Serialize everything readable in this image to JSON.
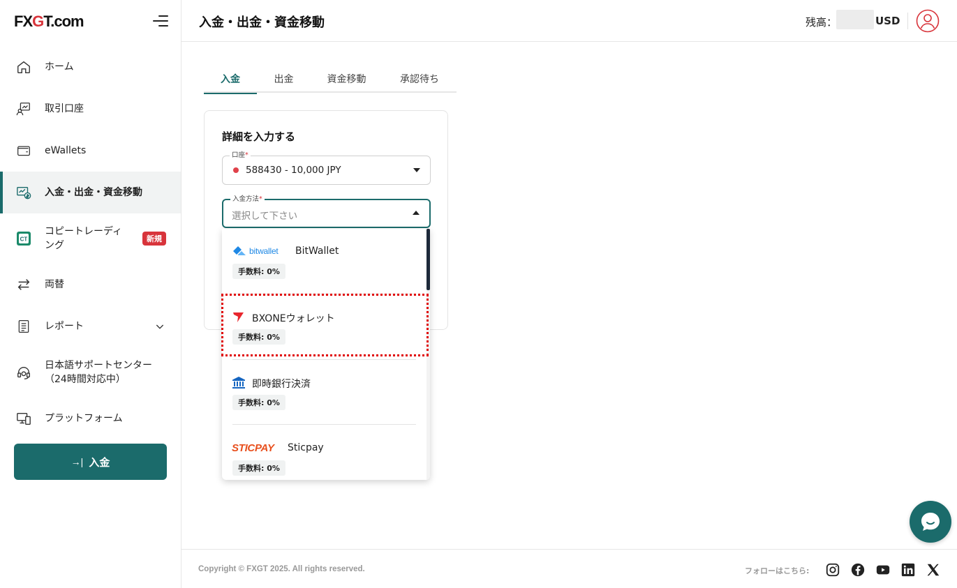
{
  "brand": {
    "logo_prefix": "FX",
    "logo_accent": "G",
    "logo_suffix": "T.com"
  },
  "sidebar": {
    "items": [
      {
        "label": "ホーム",
        "icon": "home-icon"
      },
      {
        "label": "取引口座",
        "icon": "trading-account-icon"
      },
      {
        "label": "eWallets",
        "icon": "wallet-icon"
      },
      {
        "label": "入金・出金・資金移動",
        "icon": "funds-transfer-icon",
        "active": true
      },
      {
        "label_line1": "コピートレーディ",
        "label_line2": "ング",
        "icon": "copy-trading-icon",
        "badge": "新規"
      },
      {
        "label": "両替",
        "icon": "exchange-icon"
      },
      {
        "label": "レポート",
        "icon": "report-icon"
      },
      {
        "label_line1": "日本語サポートセンター",
        "label_line2": "（24時間対応中）",
        "icon": "support-icon"
      },
      {
        "label": "プラットフォーム",
        "icon": "platform-icon"
      }
    ],
    "deposit_button": "入金",
    "deposit_arrow": "→|"
  },
  "header": {
    "title": "入金・出金・資金移動",
    "balance_label": "残高：",
    "balance_currency": "USD"
  },
  "tabs": [
    "入金",
    "出金",
    "資金移動",
    "承認待ち"
  ],
  "form": {
    "title": "詳細を入力する",
    "account_label": "口座",
    "account_value": "588430 - 10,000 JPY",
    "method_label": "入金方法",
    "required_mark": "*",
    "method_placeholder": "選択して下さい"
  },
  "methods": [
    {
      "name": "BitWallet",
      "logo_text": "bitwallet",
      "fee": "手数料: 0%"
    },
    {
      "name": "BXONEウォレット",
      "fee": "手数料: 0%"
    },
    {
      "name": "即時銀行決済",
      "fee": "手数料: 0%"
    },
    {
      "name": "Sticpay",
      "logo_text": "STICPAY",
      "fee": "手数料: 0%"
    }
  ],
  "footer": {
    "copyright": "Copyright © FXGT 2025. All rights reserved.",
    "follow": "フォローはこちら:"
  },
  "colors": {
    "primary": "#1b6b6b",
    "accent_red": "#d8343b",
    "highlight": "#e00000"
  }
}
